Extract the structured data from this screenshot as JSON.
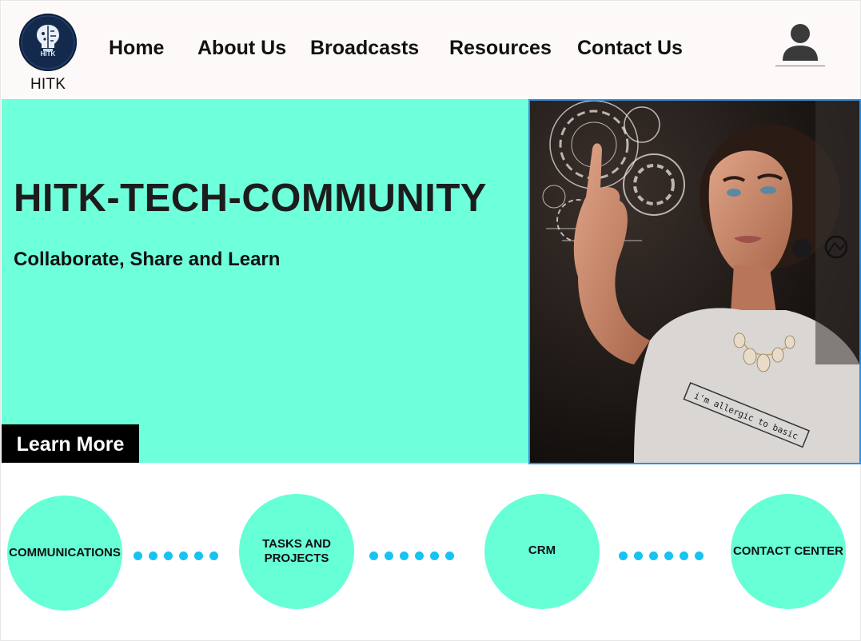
{
  "header": {
    "logo_text": "HITK",
    "logo_caption": "HITK",
    "nav": [
      {
        "label": "Home"
      },
      {
        "label": "About Us"
      },
      {
        "label": "Broadcasts"
      },
      {
        "label": "Resources"
      },
      {
        "label": "Contact Us"
      }
    ],
    "profile_icon": "user-icon"
  },
  "hero": {
    "title": "HITK-TECH-COMMUNITY",
    "subtitle": "Collaborate, Share and Learn",
    "cta_label": "Learn More",
    "shirt_text": "i'm allergic to basic"
  },
  "features": [
    {
      "label": "COMMUNICATIONS"
    },
    {
      "label": "TASKS AND PROJECTS"
    },
    {
      "label": "CRM"
    },
    {
      "label": "CONTACT CENTER"
    }
  ],
  "colors": {
    "hero_bg": "#6effdb",
    "circle_bg": "#66ffd6",
    "dot": "#16c3f2",
    "button_bg": "#000000",
    "image_border": "#2f8fe0"
  }
}
